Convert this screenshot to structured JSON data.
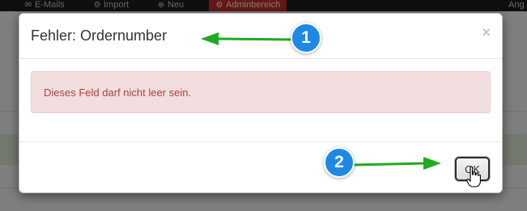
{
  "navbar": {
    "items": [
      {
        "icon": "envelope-icon",
        "label": "E-Mails"
      },
      {
        "icon": "gear-icon",
        "label": "Import"
      },
      {
        "icon": "plus-circle-icon",
        "label": "Neu"
      },
      {
        "icon": "gear-icon",
        "label": "Adminbereich"
      }
    ],
    "user_partial": "Ang"
  },
  "modal": {
    "title": "Fehler: Ordernumber",
    "close_label": "×",
    "alert_text": "Dieses Feld darf nicht leer sein.",
    "ok_label": "OK"
  },
  "annotations": {
    "badge_1": "1",
    "badge_2": "2"
  },
  "colors": {
    "alert_bg": "#f2dede",
    "alert_text": "#a94442",
    "badge": "#1e88e5",
    "arrow": "#1faa1f",
    "nav_active": "#c9302c"
  }
}
